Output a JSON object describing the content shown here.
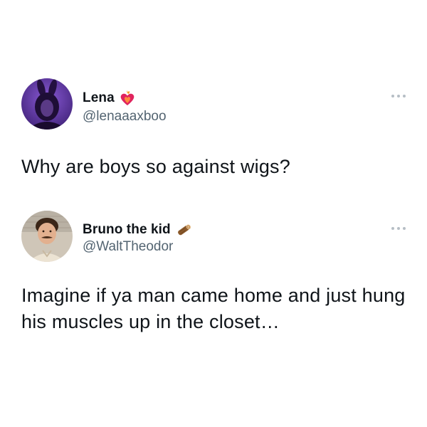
{
  "tweets": [
    {
      "display_name": "Lena",
      "handle": "@lenaaaxboo",
      "badge_icon": "heart-on-fire-icon",
      "text": "Why are boys so against wigs?"
    },
    {
      "display_name": "Bruno the kid",
      "handle": "@WaltTheodor",
      "badge_icon": "wood-log-icon",
      "text": "Imagine if ya man came home and just hung his muscles up in the closet…"
    }
  ],
  "colors": {
    "text": "#0f1419",
    "handle": "#536471",
    "more_dots": "#b6bec5",
    "avatar_1_bg": "#4b2a8c",
    "badge_heart": "#e0245e"
  }
}
